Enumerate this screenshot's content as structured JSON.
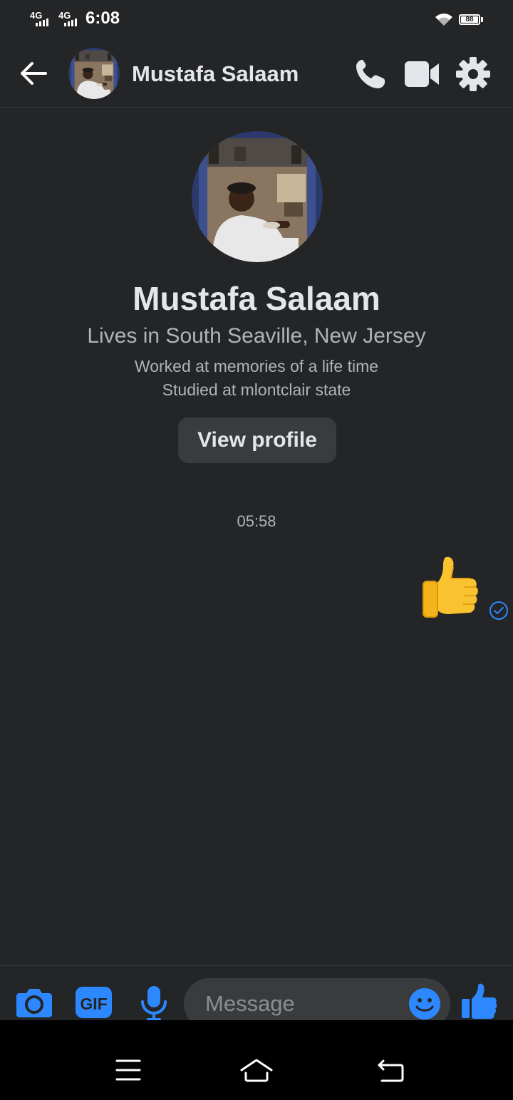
{
  "status_bar": {
    "network_1": "4G",
    "network_2": "4G",
    "time": "6:08",
    "battery": "88"
  },
  "header": {
    "contact_name": "Mustafa Salaam",
    "icons": [
      "back-arrow-icon",
      "phone-icon",
      "video-camera-icon",
      "gear-icon"
    ]
  },
  "profile": {
    "name": "Mustafa Salaam",
    "location": "Lives in South Seaville, New Jersey",
    "work": "Worked at memories of a life time",
    "education": "Studied at mlontclair  state",
    "view_profile_label": "View profile"
  },
  "conversation": {
    "timestamp": "05:58",
    "messages": [
      {
        "type": "like-sticker",
        "direction": "outgoing",
        "status": "sent"
      }
    ]
  },
  "composer": {
    "placeholder": "Message",
    "icons": [
      "camera-icon",
      "gif-icon",
      "microphone-icon",
      "emoji-icon",
      "thumbs-up-icon"
    ]
  },
  "nav_bar": {
    "icons": [
      "menu-icon",
      "home-icon",
      "back-icon"
    ]
  },
  "colors": {
    "background": "#242526",
    "accent": "#2d88ff",
    "text_primary": "#e4e6eb",
    "text_secondary": "#b0b3b8"
  }
}
